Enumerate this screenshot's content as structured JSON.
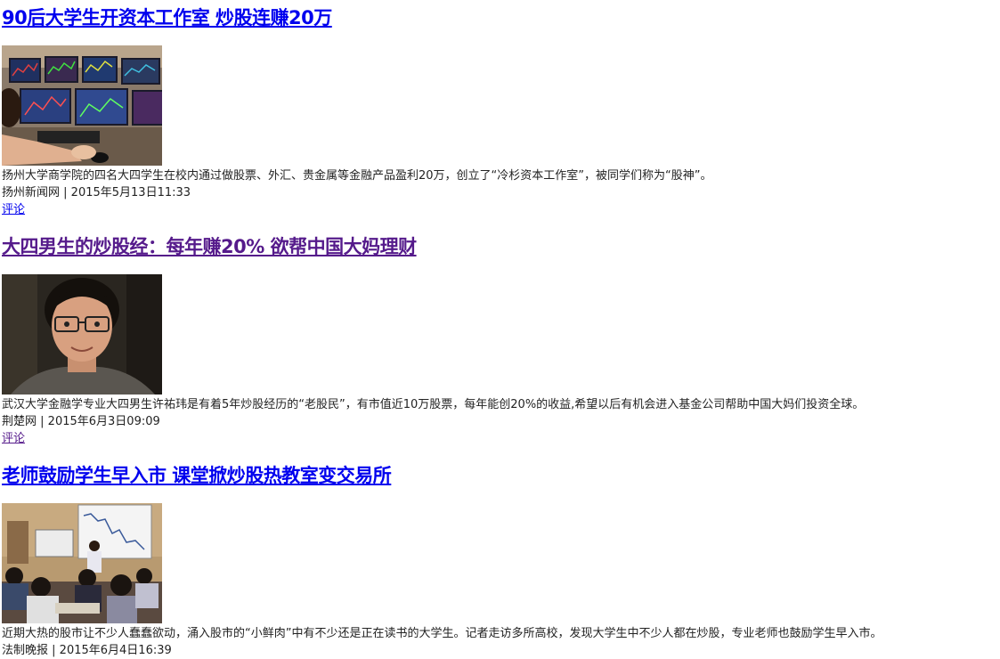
{
  "articles": [
    {
      "title": "90后大学生开资本工作室 炒股连赚20万",
      "title_state": "unvisited",
      "image": "trading-monitors",
      "summary": "扬州大学商学院的四名大四学生在校内通过做股票、外汇、贵金属等金融产品盈利20万，创立了“冷杉资本工作室”，被同学们称为“股神”。",
      "source": "扬州新闻网",
      "separator": "|",
      "time": "2015年5月13日11:33",
      "comment_label": "评论",
      "comment_state": "unvisited"
    },
    {
      "title": "大四男生的炒股经：每年赚20% 欲帮中国大妈理财",
      "title_state": "visited",
      "image": "student-portrait",
      "summary": "武汉大学金融学专业大四男生许祐玮是有着5年炒股经历的“老股民”，有市值近10万股票，每年能创20%的收益,希望以后有机会进入基金公司帮助中国大妈们投资全球。",
      "source": "荆楚网",
      "separator": "|",
      "time": "2015年6月3日09:09",
      "comment_label": "评论",
      "comment_state": "visited"
    },
    {
      "title": "老师鼓励学生早入市 课堂掀炒股热教室变交易所",
      "title_state": "unvisited",
      "image": "classroom-lecture",
      "summary": "近期大热的股市让不少人蠢蠢欲动，涌入股市的“小鲜肉”中有不少还是正在读书的大学生。记者走访多所高校，发现大学生中不少人都在炒股，专业老师也鼓励学生早入市。",
      "source": "法制晚报",
      "separator": "|",
      "time": "2015年6月4日16:39"
    }
  ]
}
